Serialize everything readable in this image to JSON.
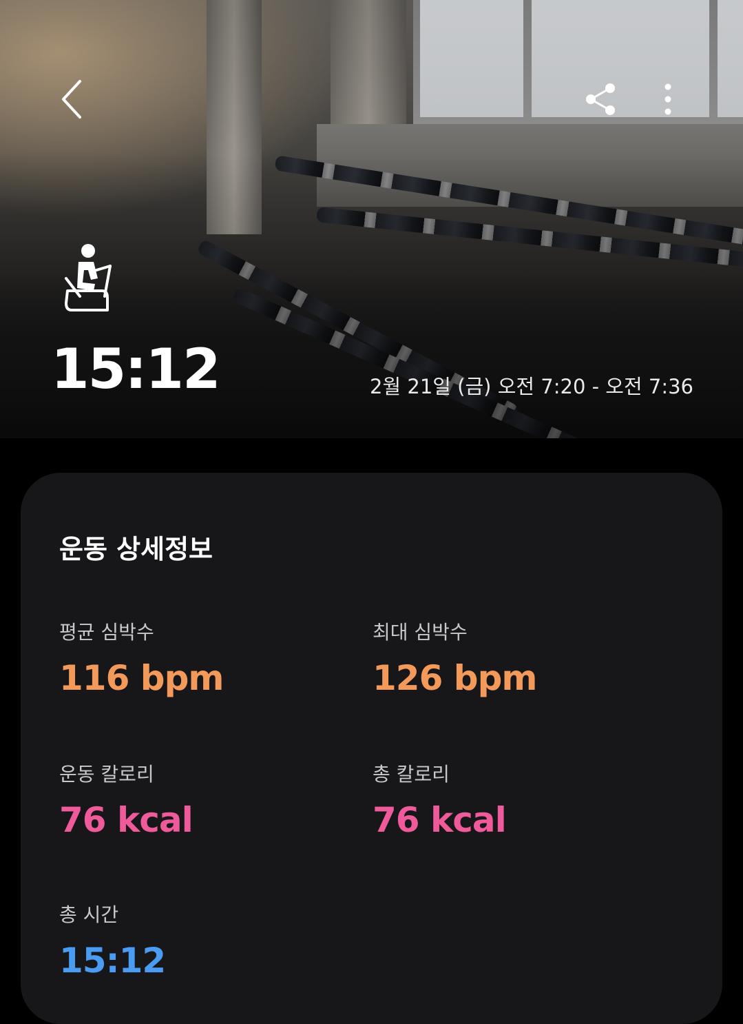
{
  "header": {
    "back_icon": "chevron-left-icon",
    "share_icon": "share-icon",
    "more_icon": "more-vertical-icon",
    "exercise_icon": "exercise-bike-icon",
    "duration": "15:12",
    "time_range": "2월 21일 (금) 오전 7:20 - 오전 7:36"
  },
  "details": {
    "title": "운동 상세정보",
    "metrics": [
      {
        "label": "평균 심박수",
        "value": "116 bpm",
        "color": "#f39a5a"
      },
      {
        "label": "최대 심박수",
        "value": "126 bpm",
        "color": "#f39a5a"
      },
      {
        "label": "운동 칼로리",
        "value": "76 kcal",
        "color": "#ef5a9a"
      },
      {
        "label": "총 칼로리",
        "value": "76 kcal",
        "color": "#ef5a9a"
      },
      {
        "label": "총 시간",
        "value": "15:12",
        "color": "#4a9bf2"
      }
    ]
  }
}
